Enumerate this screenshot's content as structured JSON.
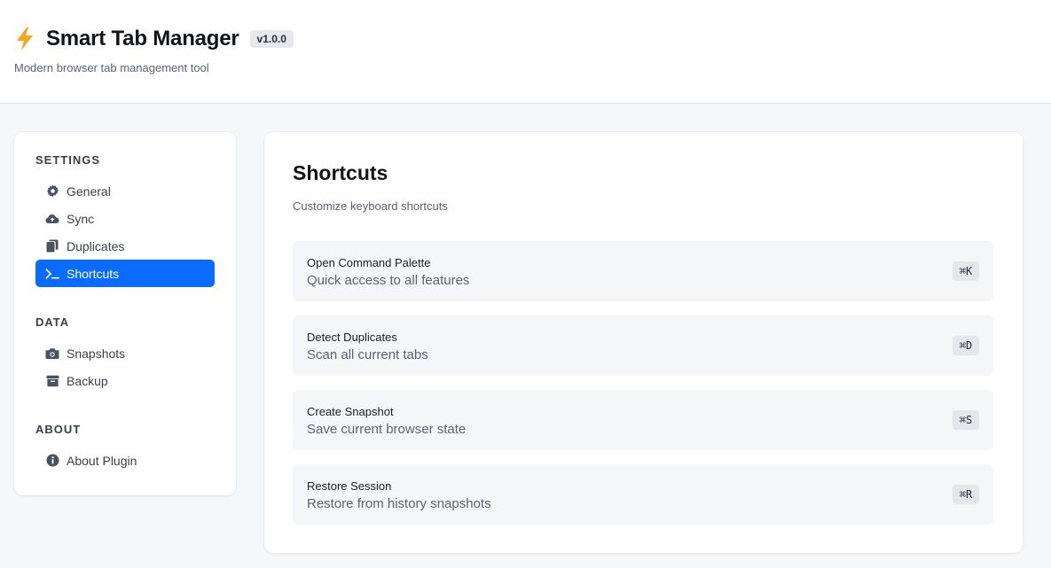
{
  "header": {
    "title": "Smart Tab Manager",
    "version": "v1.0.0",
    "subtitle": "Modern browser tab management tool",
    "logo_icon": "lightning-bolt-icon"
  },
  "sidebar": {
    "sections": [
      {
        "title": "SETTINGS",
        "items": [
          {
            "label": "General",
            "icon": "gear-icon"
          },
          {
            "label": "Sync",
            "icon": "cloud-icon"
          },
          {
            "label": "Duplicates",
            "icon": "copy-icon"
          },
          {
            "label": "Shortcuts",
            "icon": "terminal-icon",
            "active": true
          }
        ]
      },
      {
        "title": "DATA",
        "items": [
          {
            "label": "Snapshots",
            "icon": "camera-icon"
          },
          {
            "label": "Backup",
            "icon": "archive-icon"
          }
        ]
      },
      {
        "title": "ABOUT",
        "items": [
          {
            "label": "About Plugin",
            "icon": "info-icon"
          }
        ]
      }
    ]
  },
  "main": {
    "title": "Shortcuts",
    "description": "Customize keyboard shortcuts",
    "shortcuts": [
      {
        "name": "Open Command Palette",
        "description": "Quick access to all features",
        "key": "⌘K"
      },
      {
        "name": "Detect Duplicates",
        "description": "Scan all current tabs",
        "key": "⌘D"
      },
      {
        "name": "Create Snapshot",
        "description": "Save current browser state",
        "key": "⌘S"
      },
      {
        "name": "Restore Session",
        "description": "Restore from history snapshots",
        "key": "⌘R"
      }
    ]
  },
  "colors": {
    "accent": "#0a6cff",
    "logo": "#f5a623",
    "background": "#f6f7f9"
  }
}
